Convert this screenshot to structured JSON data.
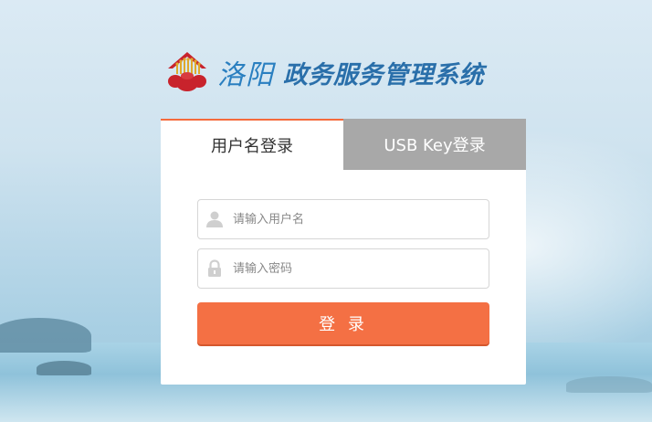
{
  "header": {
    "city": "洛阳",
    "system_name": "政务服务管理系统",
    "logo_icon": "red-crown-emblem-icon"
  },
  "tabs": [
    {
      "label": "用户名登录",
      "active": true
    },
    {
      "label": "USB Key登录",
      "active": false
    }
  ],
  "form": {
    "username": {
      "placeholder": "请输入用户名",
      "value": "",
      "icon": "user-icon"
    },
    "password": {
      "placeholder": "请输入密码",
      "value": "",
      "icon": "lock-icon"
    },
    "submit_label": "登 录"
  },
  "colors": {
    "accent": "#f47044",
    "title_blue": "#2a7fc0",
    "inactive_tab": "#a8a8a8"
  }
}
